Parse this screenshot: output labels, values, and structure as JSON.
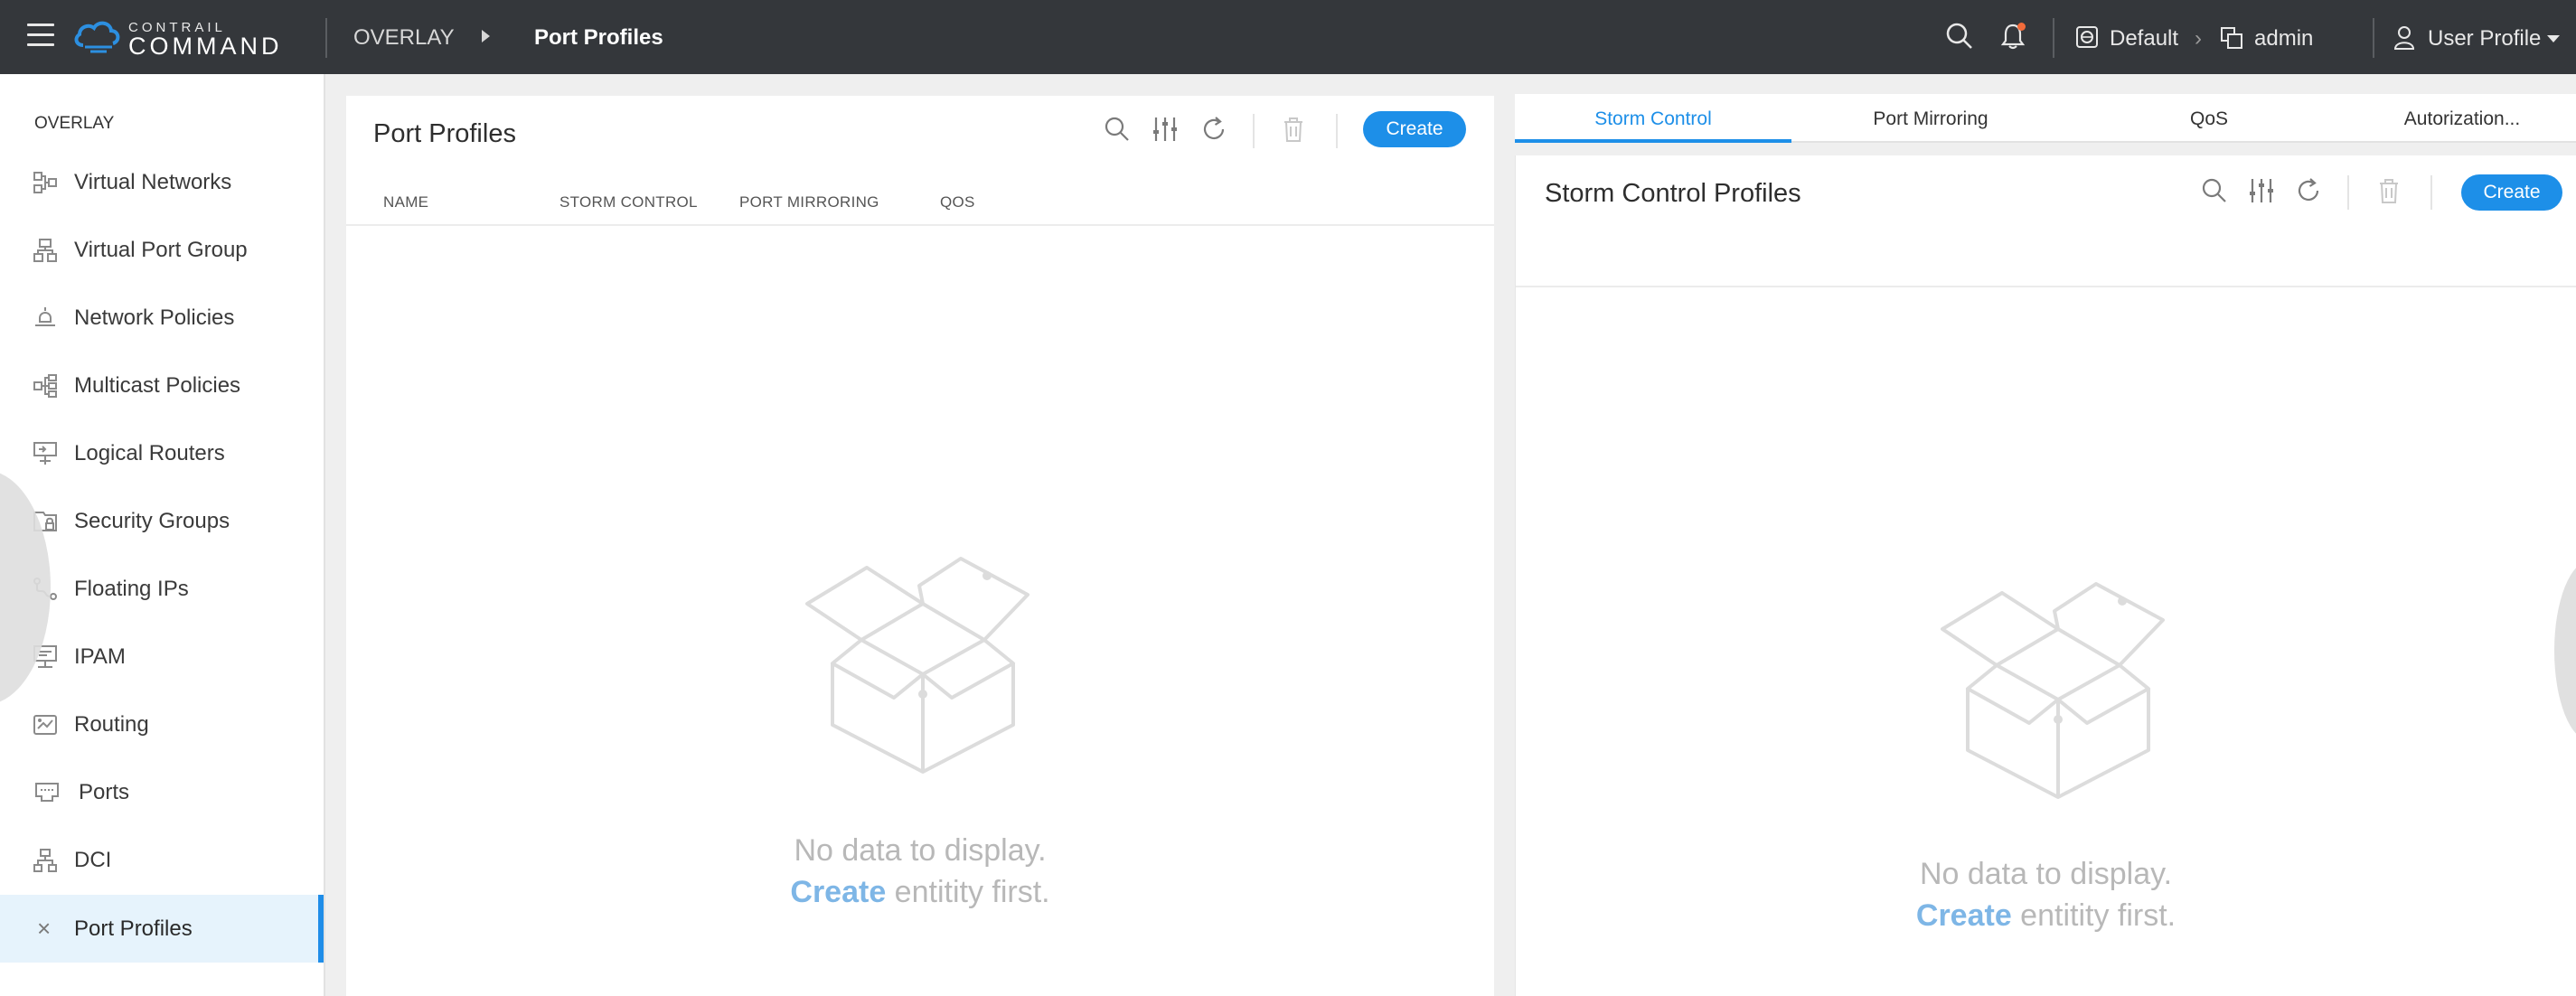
{
  "topbar": {
    "brand_top": "CONTRAIL",
    "brand_main": "COMMAND",
    "breadcrumb": [
      "OVERLAY",
      "Port Profiles"
    ],
    "domain": "Default",
    "project": "admin",
    "user": "User Profile",
    "notification_color": "#f26b3a"
  },
  "sidebar": {
    "heading": "OVERLAY",
    "items": [
      {
        "label": "Virtual Networks",
        "icon": "virtual-networks-icon"
      },
      {
        "label": "Virtual Port Group",
        "icon": "virtual-port-group-icon"
      },
      {
        "label": "Network Policies",
        "icon": "network-policies-icon"
      },
      {
        "label": "Multicast Policies",
        "icon": "multicast-policies-icon"
      },
      {
        "label": "Logical Routers",
        "icon": "logical-routers-icon"
      },
      {
        "label": "Security Groups",
        "icon": "security-groups-icon"
      },
      {
        "label": "Floating IPs",
        "icon": "floating-ips-icon"
      },
      {
        "label": "IPAM",
        "icon": "ipam-icon"
      },
      {
        "label": "Routing",
        "icon": "routing-icon"
      },
      {
        "label": "Ports",
        "icon": "ports-icon"
      },
      {
        "label": "DCI",
        "icon": "dci-icon"
      },
      {
        "label": "Port Profiles",
        "icon": "close-icon",
        "active": true
      }
    ]
  },
  "left_panel": {
    "title": "Port Profiles",
    "create_label": "Create",
    "columns": [
      "NAME",
      "STORM CONTROL",
      "PORT MIRRORING",
      "QOS"
    ],
    "empty_line1": "No data to display.",
    "empty_link": "Create",
    "empty_rest": " entitity first."
  },
  "right_tabs": [
    "Storm Control",
    "Port Mirroring",
    "QoS",
    "Autorization..."
  ],
  "right_panel": {
    "title": "Storm Control Profiles",
    "create_label": "Create",
    "empty_line1": "No data to display.",
    "empty_link": "Create",
    "empty_rest": " entitity first."
  },
  "colors": {
    "accent": "#1d8fe8",
    "topbar": "#34373b",
    "active_item_bg": "#e6f3fc"
  }
}
